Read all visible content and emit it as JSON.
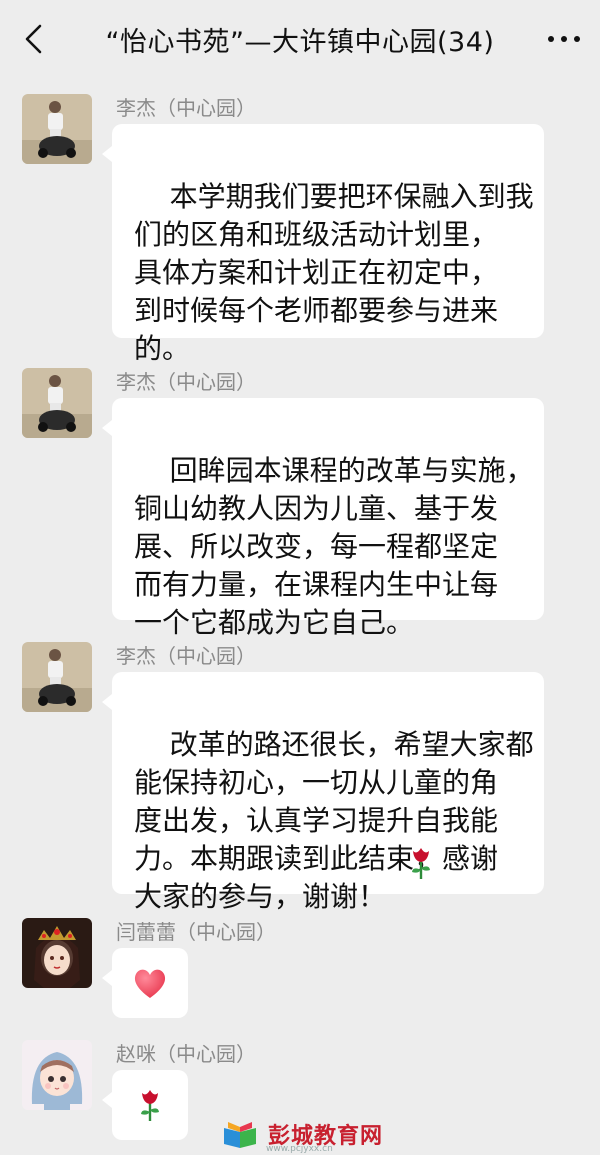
{
  "header": {
    "title": "“怡心书苑”—大许镇中心园(34)",
    "back_icon": "chevron-left-icon",
    "more_icon": "more-horizontal-icon"
  },
  "messages": [
    {
      "sender": "李杰（中心园）",
      "avatar": "avatar-child-on-toy-car",
      "text": "本学期我们要把环保融入到我\n们的区角和班级活动计划里，\n具体方案和计划正在初定中，\n到时候每个老师都要参与进来\n的。"
    },
    {
      "sender": "李杰（中心园）",
      "avatar": "avatar-child-on-toy-car",
      "text": "回眸园本课程的改革与实施，\n铜山幼教人因为儿童、基于发\n展、所以改变，每一程都坚定\n而有力量，在课程内生中让每\n一个它都成为它自己。"
    },
    {
      "sender": "李杰（中心园）",
      "avatar": "avatar-child-on-toy-car",
      "text": "改革的路还很长，希望大家都\n能保持初心，一切从儿童的角\n度出发，认真学习提升自我能\n力。本期跟读到此结束，感谢\n大家的参与，谢谢！",
      "emoji": "rose-icon"
    },
    {
      "sender": "闫蕾蕾（中心园）",
      "avatar": "avatar-anime-girl-headdress",
      "emoji": "heart-icon"
    },
    {
      "sender": "赵咪（中心园）",
      "avatar": "avatar-cartoon-girl-hood",
      "emoji": "rose-icon"
    }
  ],
  "watermark": {
    "text": "彭城教育网",
    "url": "www.pcjyxx.cn"
  },
  "colors": {
    "background": "#ededed",
    "bubble": "#ffffff",
    "sender": "#8a8a8a",
    "heart": "#e8384f",
    "rose": "#c8102e",
    "watermark": "#c8202f"
  }
}
